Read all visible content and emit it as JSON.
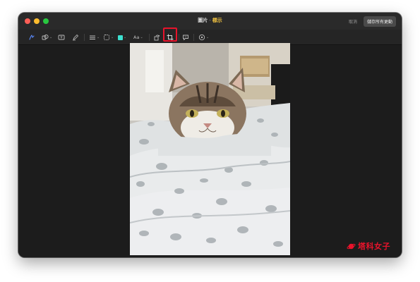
{
  "window": {
    "title": "圖片",
    "title_separator": "-",
    "title_subtitle": "標示",
    "cancel_label": "取消",
    "save_label": "儲存所有更動"
  },
  "toolbar": {
    "tools": [
      "sketch-icon",
      "shapes-icon",
      "text-box-icon",
      "highlight-icon",
      "line-style-icon",
      "border-color-icon",
      "fill-color-icon",
      "text-style-icon",
      "rotate-icon",
      "crop-icon",
      "description-icon",
      "accessory-icon"
    ],
    "text_style_label": "Aa",
    "fill_color": "#3de0d0",
    "highlighted_tool": "crop-icon",
    "highlight_color": "#e8132b"
  },
  "image": {
    "subject": "cat",
    "blanket": "grey-spotted"
  },
  "watermark": {
    "text": "塔科女子"
  }
}
